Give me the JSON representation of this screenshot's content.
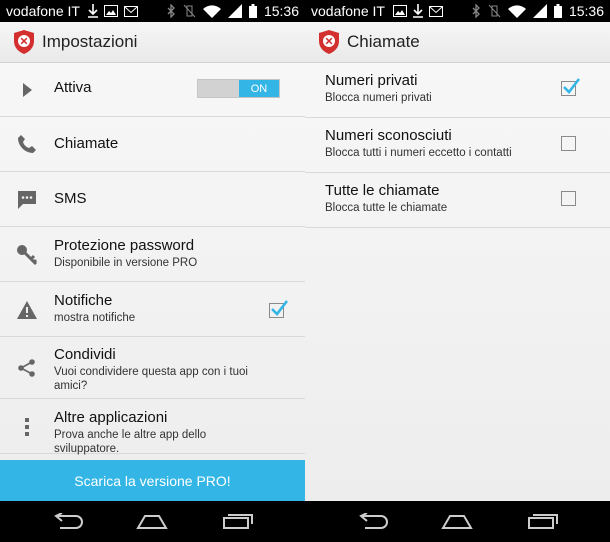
{
  "colors": {
    "accent": "#33b5e5",
    "status_bg": "#000000"
  },
  "status_bar": {
    "carrier": "vodafone IT",
    "time": "15:36"
  },
  "left": {
    "title": "Impostazioni",
    "items": [
      {
        "label": "Attiva",
        "icon": "play-arrow-icon",
        "toggle": "ON"
      },
      {
        "label": "Chiamate",
        "icon": "phone-icon"
      },
      {
        "label": "SMS",
        "icon": "sms-icon"
      },
      {
        "label": "Protezione password",
        "sub": "Disponibile in versione PRO",
        "icon": "key-icon"
      },
      {
        "label": "Notifiche",
        "sub": "mostra notifiche",
        "icon": "warning-icon",
        "checked": true
      },
      {
        "label": "Condividi",
        "sub": "Vuoi condividere questa app con i tuoi amici?",
        "icon": "share-icon"
      },
      {
        "label": "Altre applicazioni",
        "sub": "Prova anche le altre app dello sviluppatore.",
        "icon": "more-vert-icon"
      }
    ],
    "pro_button": "Scarica la versione PRO!"
  },
  "right": {
    "title": "Chiamate",
    "items": [
      {
        "label": "Numeri privati",
        "sub": "Blocca numeri privati",
        "checked": true
      },
      {
        "label": "Numeri sconosciuti",
        "sub": "Blocca tutti i numeri eccetto i contatti",
        "checked": false
      },
      {
        "label": "Tutte le chiamate",
        "sub": "Blocca tutte le chiamate",
        "checked": false
      }
    ]
  }
}
